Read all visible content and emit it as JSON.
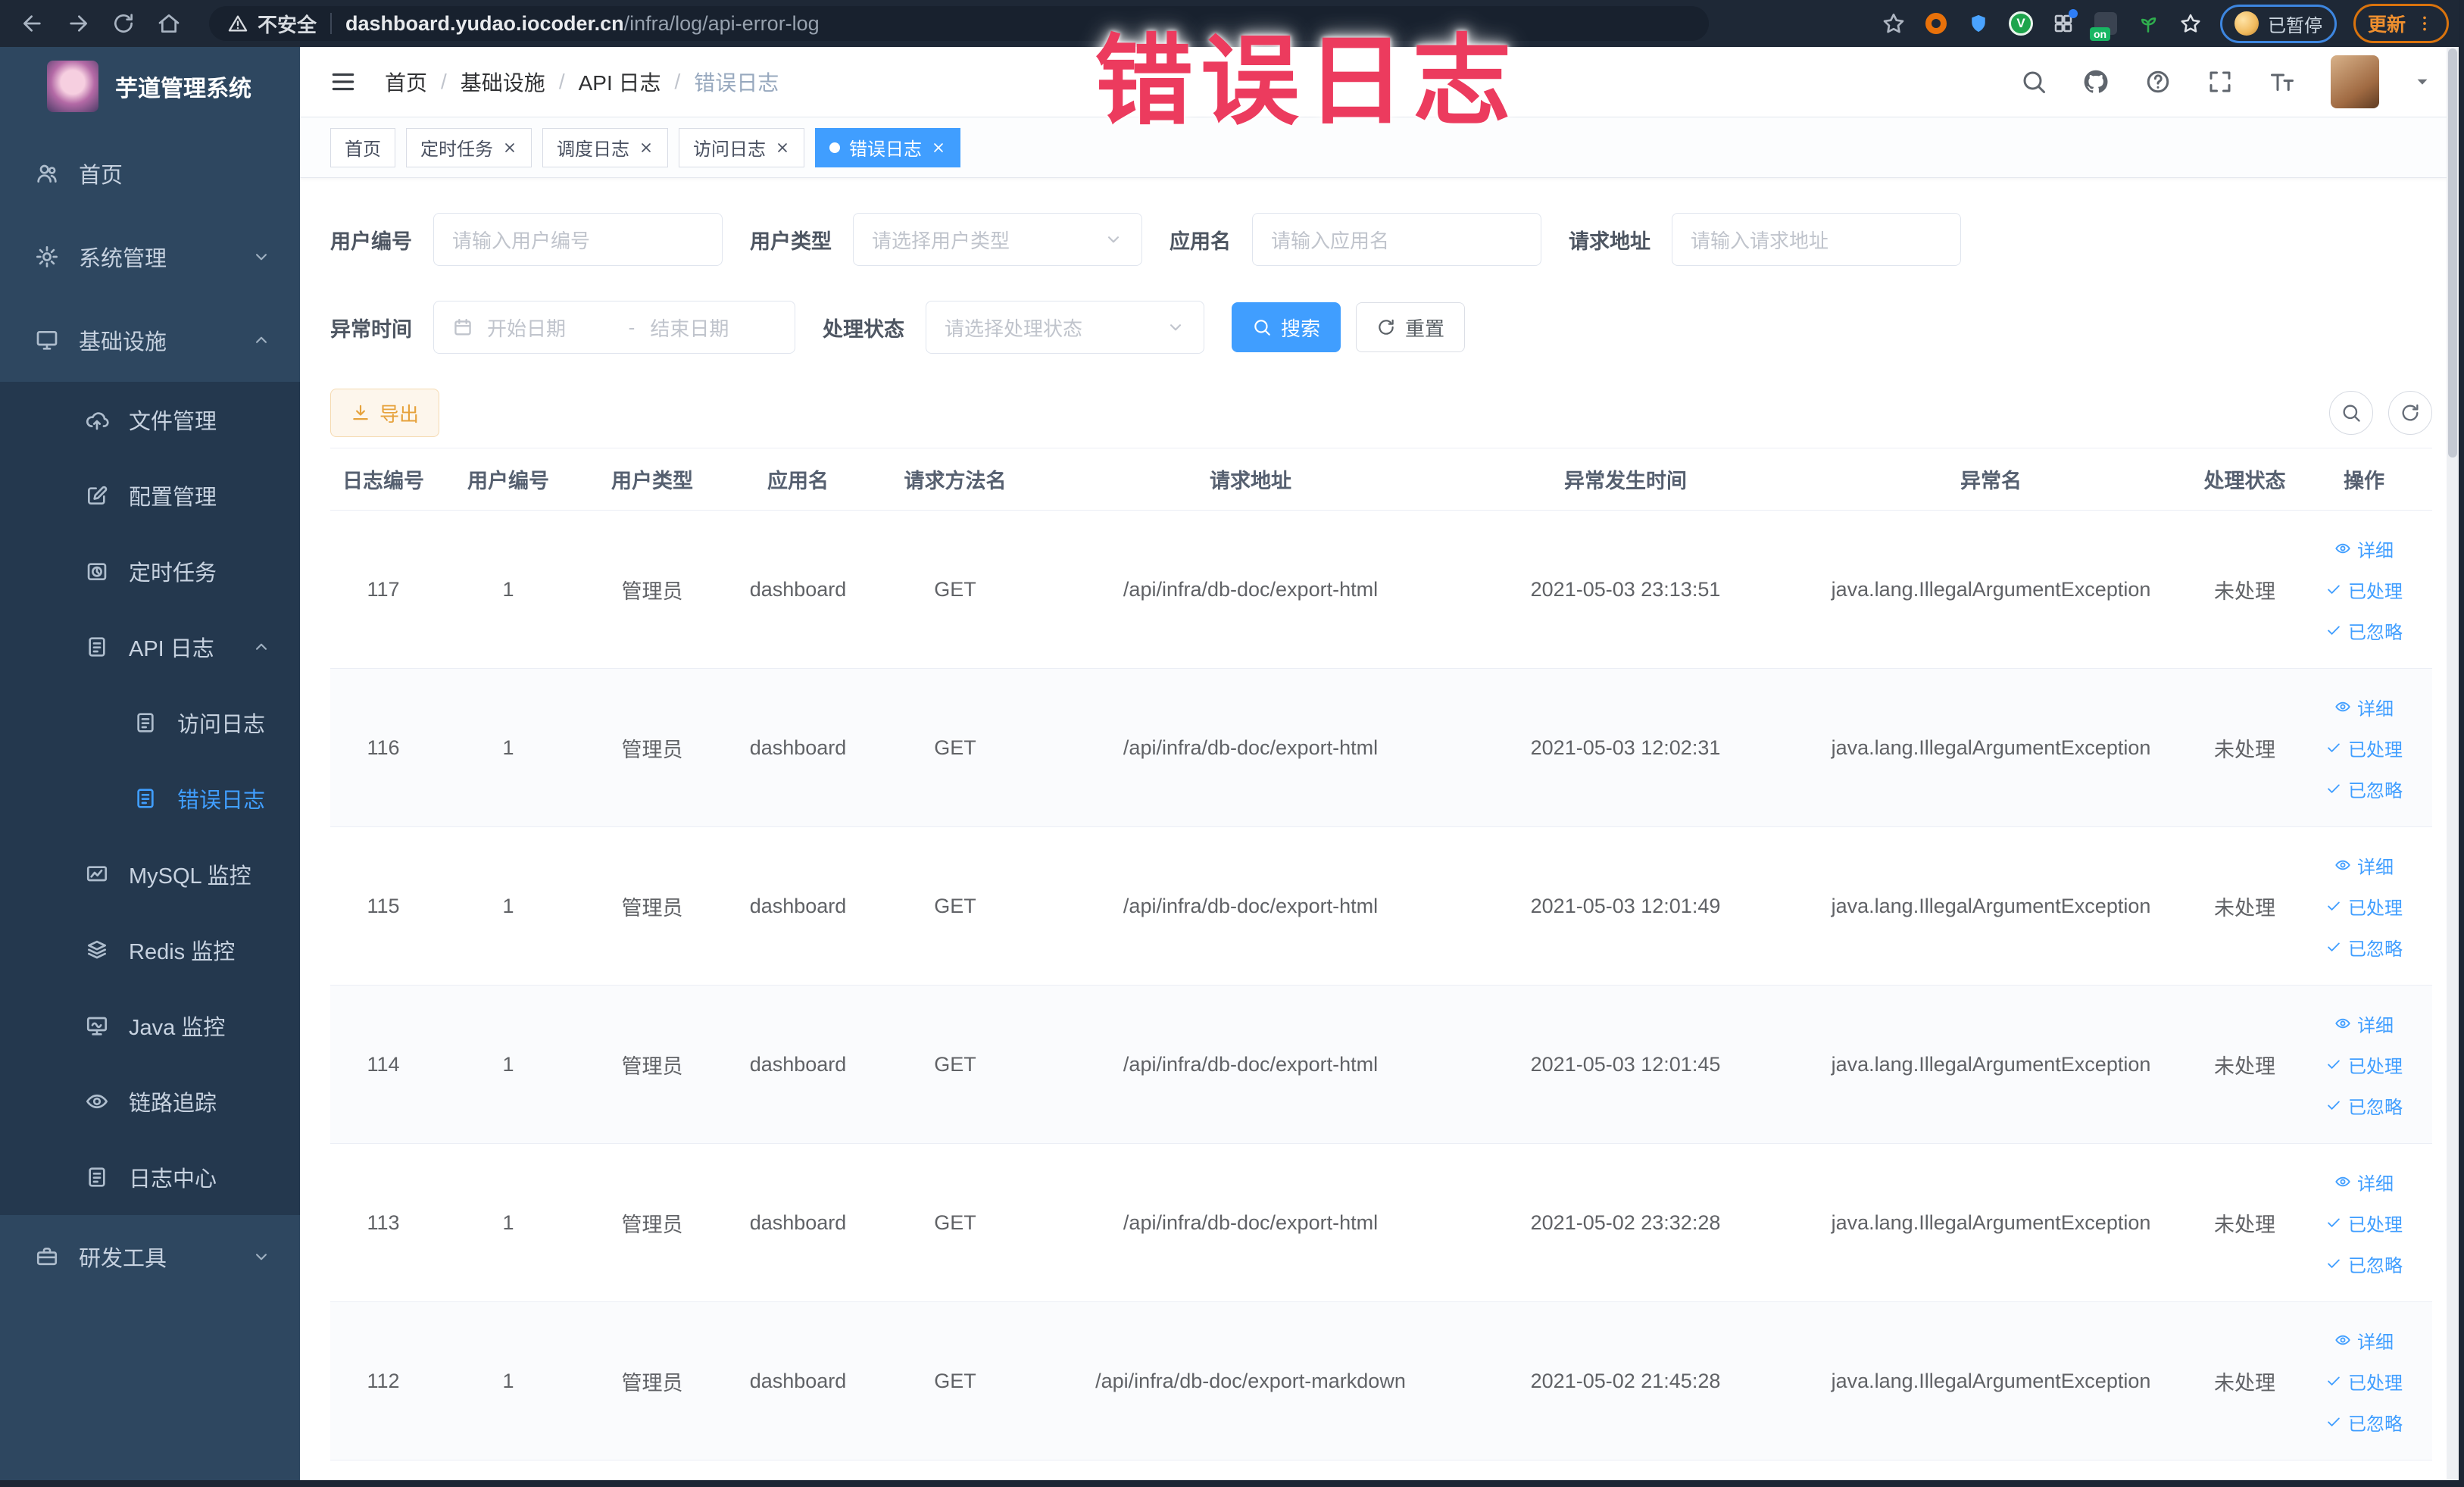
{
  "browser": {
    "security_label": "不安全",
    "url_host": "dashboard.yudao.iocoder.cn",
    "url_path": "/infra/log/api-error-log",
    "paused_badge_label": "已暂停",
    "update_button_label": "更新"
  },
  "watermark_text": "错误日志",
  "sidebar": {
    "logo_title": "芋道管理系统",
    "items": [
      {
        "key": "home",
        "label": "首页",
        "icon": "people",
        "level": 0,
        "chevron": null,
        "active": false,
        "group": false
      },
      {
        "key": "system-management",
        "label": "系统管理",
        "icon": "gear",
        "level": 0,
        "chevron": "down",
        "active": false,
        "group": false
      },
      {
        "key": "infrastructure",
        "label": "基础设施",
        "icon": "monitor",
        "level": 0,
        "chevron": "up",
        "active": false,
        "group": false
      },
      {
        "key": "file-management",
        "label": "文件管理",
        "icon": "cloud-upload",
        "level": 1,
        "chevron": null,
        "active": false,
        "group": true
      },
      {
        "key": "config-management",
        "label": "配置管理",
        "icon": "edit",
        "level": 1,
        "chevron": null,
        "active": false,
        "group": true
      },
      {
        "key": "scheduled-tasks",
        "label": "定时任务",
        "icon": "clock",
        "level": 1,
        "chevron": null,
        "active": false,
        "group": true
      },
      {
        "key": "api-log",
        "label": "API 日志",
        "icon": "log",
        "level": 1,
        "chevron": "up",
        "active": false,
        "group": true
      },
      {
        "key": "access-log",
        "label": "访问日志",
        "icon": "log",
        "level": 2,
        "chevron": null,
        "active": false,
        "group": true
      },
      {
        "key": "error-log",
        "label": "错误日志",
        "icon": "log",
        "level": 2,
        "chevron": null,
        "active": true,
        "group": true
      },
      {
        "key": "mysql-monitor",
        "label": "MySQL 监控",
        "icon": "mysql",
        "level": 1,
        "chevron": null,
        "active": false,
        "group": true
      },
      {
        "key": "redis-monitor",
        "label": "Redis 监控",
        "icon": "redis",
        "level": 1,
        "chevron": null,
        "active": false,
        "group": true
      },
      {
        "key": "java-monitor",
        "label": "Java 监控",
        "icon": "java",
        "level": 1,
        "chevron": null,
        "active": false,
        "group": true
      },
      {
        "key": "trace",
        "label": "链路追踪",
        "icon": "eye",
        "level": 1,
        "chevron": null,
        "active": false,
        "group": true
      },
      {
        "key": "log-center",
        "label": "日志中心",
        "icon": "log",
        "level": 1,
        "chevron": null,
        "active": false,
        "group": true
      },
      {
        "key": "dev-tools",
        "label": "研发工具",
        "icon": "toolbox",
        "level": 0,
        "chevron": "down",
        "active": false,
        "group": false
      }
    ]
  },
  "header": {
    "breadcrumb": [
      "首页",
      "基础设施",
      "API 日志",
      "错误日志"
    ]
  },
  "tags": [
    {
      "label": "首页",
      "closable": false,
      "active": false
    },
    {
      "label": "定时任务",
      "closable": true,
      "active": false
    },
    {
      "label": "调度日志",
      "closable": true,
      "active": false
    },
    {
      "label": "访问日志",
      "closable": true,
      "active": false
    },
    {
      "label": "错误日志",
      "closable": true,
      "active": true
    }
  ],
  "filters": {
    "user_id": {
      "label": "用户编号",
      "placeholder": "请输入用户编号"
    },
    "user_type": {
      "label": "用户类型",
      "placeholder": "请选择用户类型"
    },
    "app_name": {
      "label": "应用名",
      "placeholder": "请输入应用名"
    },
    "request_url": {
      "label": "请求地址",
      "placeholder": "请输入请求地址"
    },
    "exception_time": {
      "label": "异常时间",
      "start_placeholder": "开始日期",
      "separator": "-",
      "end_placeholder": "结束日期"
    },
    "process_status": {
      "label": "处理状态",
      "placeholder": "请选择处理状态"
    },
    "search_button": "搜索",
    "reset_button": "重置"
  },
  "toolbar": {
    "export_button": "导出"
  },
  "table": {
    "columns": [
      "日志编号",
      "用户编号",
      "用户类型",
      "应用名",
      "请求方法名",
      "请求地址",
      "异常发生时间",
      "异常名",
      "处理状态",
      "操作"
    ],
    "actions": {
      "detail": "详细",
      "processed": "已处理",
      "ignored": "已忽略"
    },
    "rows": [
      {
        "log_id": "117",
        "user_id": "1",
        "user_type": "管理员",
        "app_name": "dashboard",
        "method": "GET",
        "request_url": "/api/infra/db-doc/export-html",
        "exception_time": "2021-05-03 23:13:51",
        "exception_name": "java.lang.IllegalArgumentException",
        "status": "未处理"
      },
      {
        "log_id": "116",
        "user_id": "1",
        "user_type": "管理员",
        "app_name": "dashboard",
        "method": "GET",
        "request_url": "/api/infra/db-doc/export-html",
        "exception_time": "2021-05-03 12:02:31",
        "exception_name": "java.lang.IllegalArgumentException",
        "status": "未处理"
      },
      {
        "log_id": "115",
        "user_id": "1",
        "user_type": "管理员",
        "app_name": "dashboard",
        "method": "GET",
        "request_url": "/api/infra/db-doc/export-html",
        "exception_time": "2021-05-03 12:01:49",
        "exception_name": "java.lang.IllegalArgumentException",
        "status": "未处理"
      },
      {
        "log_id": "114",
        "user_id": "1",
        "user_type": "管理员",
        "app_name": "dashboard",
        "method": "GET",
        "request_url": "/api/infra/db-doc/export-html",
        "exception_time": "2021-05-03 12:01:45",
        "exception_name": "java.lang.IllegalArgumentException",
        "status": "未处理"
      },
      {
        "log_id": "113",
        "user_id": "1",
        "user_type": "管理员",
        "app_name": "dashboard",
        "method": "GET",
        "request_url": "/api/infra/db-doc/export-html",
        "exception_time": "2021-05-02 23:32:28",
        "exception_name": "java.lang.IllegalArgumentException",
        "status": "未处理"
      },
      {
        "log_id": "112",
        "user_id": "1",
        "user_type": "管理员",
        "app_name": "dashboard",
        "method": "GET",
        "request_url": "/api/infra/db-doc/export-markdown",
        "exception_time": "2021-05-02 21:45:28",
        "exception_name": "java.lang.IllegalArgumentException",
        "status": "未处理"
      }
    ]
  },
  "colors": {
    "accent": "#409eff",
    "warning": "#e6a23c",
    "watermark": "#ec3b5e",
    "browser_bar_bg": "#1e2836",
    "sidebar_bg": "#2e4760",
    "sidebar_submenu_bg": "#24384e"
  }
}
